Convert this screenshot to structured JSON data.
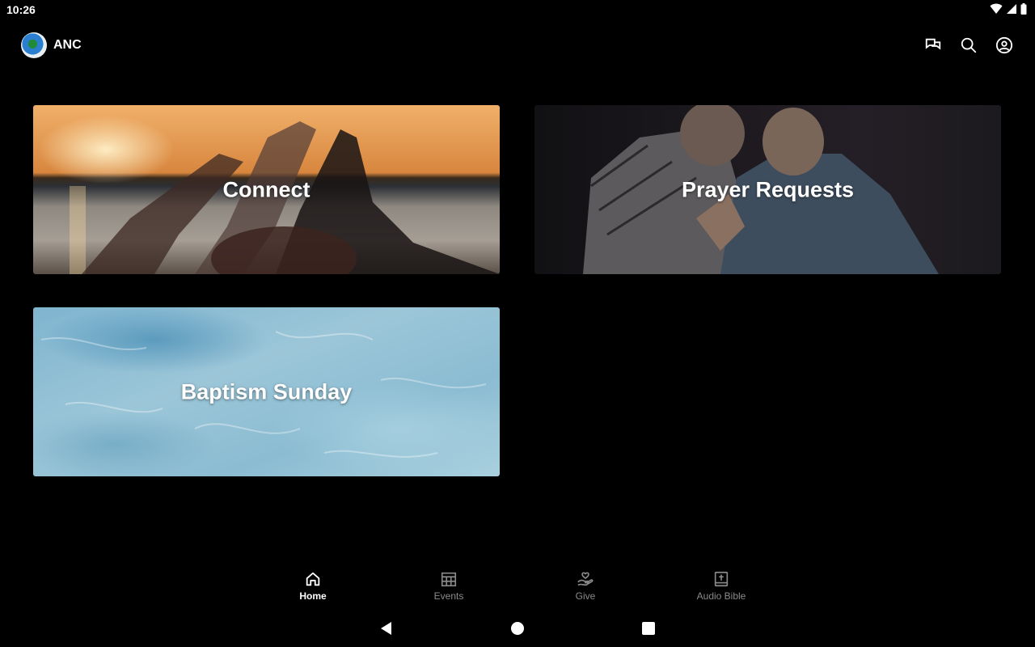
{
  "status_bar": {
    "time": "10:26"
  },
  "app_bar": {
    "title": "ANC",
    "actions": [
      "chat-icon",
      "search-icon",
      "account-icon"
    ]
  },
  "cards": [
    {
      "label": "Connect"
    },
    {
      "label": "Prayer Requests"
    },
    {
      "label": "Baptism Sunday"
    }
  ],
  "bottom_nav": {
    "items": [
      {
        "label": "Home",
        "icon": "home-icon",
        "active": true
      },
      {
        "label": "Events",
        "icon": "calendar-grid-icon",
        "active": false
      },
      {
        "label": "Give",
        "icon": "hand-heart-icon",
        "active": false
      },
      {
        "label": "Audio Bible",
        "icon": "bible-icon",
        "active": false
      }
    ]
  },
  "colors": {
    "background": "#000000",
    "active_nav": "#ffffff",
    "inactive_nav": "#8a8a8a"
  }
}
